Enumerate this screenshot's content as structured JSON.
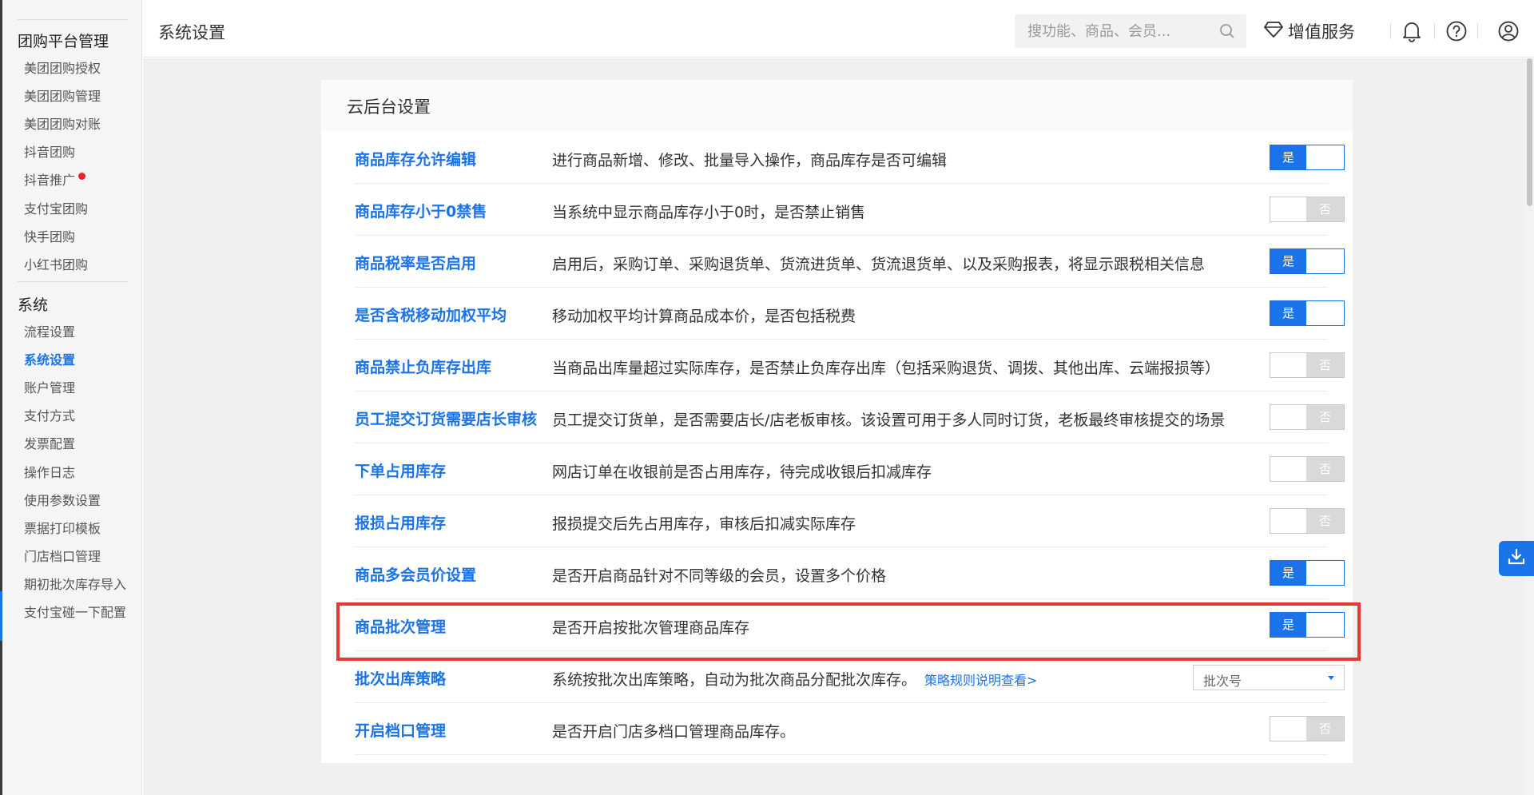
{
  "header": {
    "title": "系统设置",
    "search_placeholder": "搜功能、商品、会员...",
    "value_added_label": "增值服务"
  },
  "sidebar": {
    "groups": [
      {
        "title": "团购平台管理",
        "items": [
          {
            "label": "美团团购授权"
          },
          {
            "label": "美团团购管理"
          },
          {
            "label": "美团团购对账"
          },
          {
            "label": "抖音团购"
          },
          {
            "label": "抖音推广",
            "badge": "red-dot"
          },
          {
            "label": "支付宝团购"
          },
          {
            "label": "快手团购"
          },
          {
            "label": "小红书团购"
          }
        ]
      },
      {
        "title": "系统",
        "items": [
          {
            "label": "流程设置"
          },
          {
            "label": "系统设置",
            "active": true
          },
          {
            "label": "账户管理"
          },
          {
            "label": "支付方式"
          },
          {
            "label": "发票配置"
          },
          {
            "label": "操作日志"
          },
          {
            "label": "使用参数设置"
          },
          {
            "label": "票据打印模板"
          },
          {
            "label": "门店档口管理"
          },
          {
            "label": "期初批次库存导入"
          },
          {
            "label": "支付宝碰一下配置"
          }
        ]
      }
    ]
  },
  "card": {
    "title": "云后台设置",
    "rows": [
      {
        "name": "商品库存允许编辑",
        "desc": "进行商品新增、修改、批量导入操作，商品库存是否可编辑",
        "control": "toggle",
        "value": true
      },
      {
        "name": "商品库存小于0禁售",
        "desc": "当系统中显示商品库存小于0时，是否禁止销售",
        "control": "toggle",
        "value": false
      },
      {
        "name": "商品税率是否启用",
        "desc": "启用后，采购订单、采购退货单、货流进货单、货流退货单、以及采购报表，将显示跟税相关信息",
        "control": "toggle",
        "value": true
      },
      {
        "name": "是否含税移动加权平均",
        "desc": "移动加权平均计算商品成本价，是否包括税费",
        "control": "toggle",
        "value": true
      },
      {
        "name": "商品禁止负库存出库",
        "desc": "当商品出库量超过实际库存，是否禁止负库存出库（包括采购退货、调拨、其他出库、云端报损等）",
        "control": "toggle",
        "value": false
      },
      {
        "name": "员工提交订货需要店长审核",
        "desc": "员工提交订货单，是否需要店长/店老板审核。该设置可用于多人同时订货，老板最终审核提交的场景",
        "control": "toggle",
        "value": false
      },
      {
        "name": "下单占用库存",
        "desc": "网店订单在收银前是否占用库存，待完成收银后扣减库存",
        "control": "toggle",
        "value": false
      },
      {
        "name": "报损占用库存",
        "desc": "报损提交后先占用库存，审核后扣减实际库存",
        "control": "toggle",
        "value": false
      },
      {
        "name": "商品多会员价设置",
        "desc": "是否开启商品针对不同等级的会员，设置多个价格",
        "control": "toggle",
        "value": true
      },
      {
        "name": "商品批次管理",
        "desc": "是否开启按批次管理商品库存",
        "control": "toggle",
        "value": true,
        "highlighted": true
      },
      {
        "name": "批次出库策略",
        "desc": "系统按批次出库策略，自动为批次商品分配批次库存。",
        "link": "策略规则说明查看>",
        "control": "select",
        "select_value": "批次号"
      },
      {
        "name": "开启档口管理",
        "desc": "是否开启门店多档口管理商品库存。",
        "control": "toggle",
        "value": false
      }
    ]
  },
  "toggle_labels": {
    "on": "是",
    "off": "否"
  },
  "colors": {
    "accent": "#1a73e8",
    "highlight": "#e53935",
    "toggle_off": "#d9d9d9"
  }
}
